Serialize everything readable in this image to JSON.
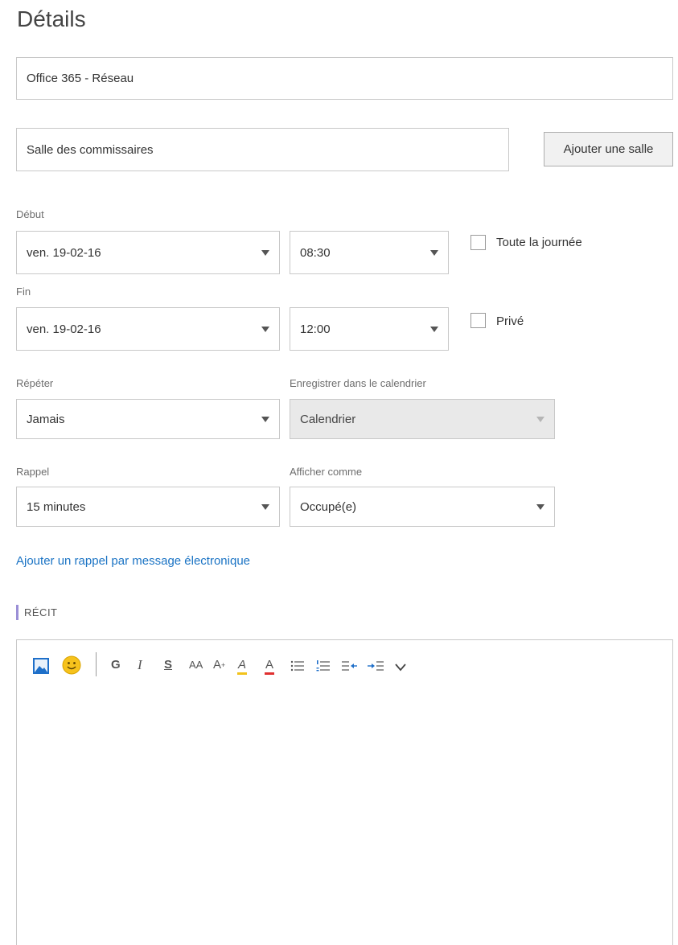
{
  "header": {
    "title": "Détails"
  },
  "subject": {
    "value": "Office 365 - Réseau"
  },
  "location": {
    "value": "Salle des commissaires",
    "add_room_label": "Ajouter une salle"
  },
  "start": {
    "label": "Début",
    "date": "ven. 19-02-16",
    "time": "08:30",
    "all_day_label": "Toute la journée"
  },
  "end": {
    "label": "Fin",
    "date": "ven. 19-02-16",
    "time": "12:00",
    "private_label": "Privé"
  },
  "repeat": {
    "label": "Répéter",
    "value": "Jamais"
  },
  "save_calendar": {
    "label": "Enregistrer dans le calendrier",
    "value": "Calendrier"
  },
  "reminder": {
    "label": "Rappel",
    "value": "15 minutes"
  },
  "show_as": {
    "label": "Afficher comme",
    "value": "Occupé(e)"
  },
  "email_reminder_link": "Ajouter un rappel par message électronique",
  "section": {
    "title": "RÉCIT"
  },
  "toolbar": {
    "bold": "G",
    "italic": "I",
    "underline": "S",
    "font_size": "AA",
    "superscript": "A",
    "highlight": "A",
    "font_color": "A",
    "more": "⌄"
  },
  "colors": {
    "link": "#1a73c4",
    "section_accent": "#9b8fd6",
    "highlight": "#f2c21b",
    "font_color": "#e03030",
    "image_icon": "#1e6fc9",
    "emoji_icon": "#f6c21c"
  },
  "icons": [
    "image-icon",
    "emoji-icon",
    "bullet-list-icon",
    "numbered-list-icon",
    "outdent-icon",
    "indent-icon",
    "chevron-down-icon"
  ]
}
